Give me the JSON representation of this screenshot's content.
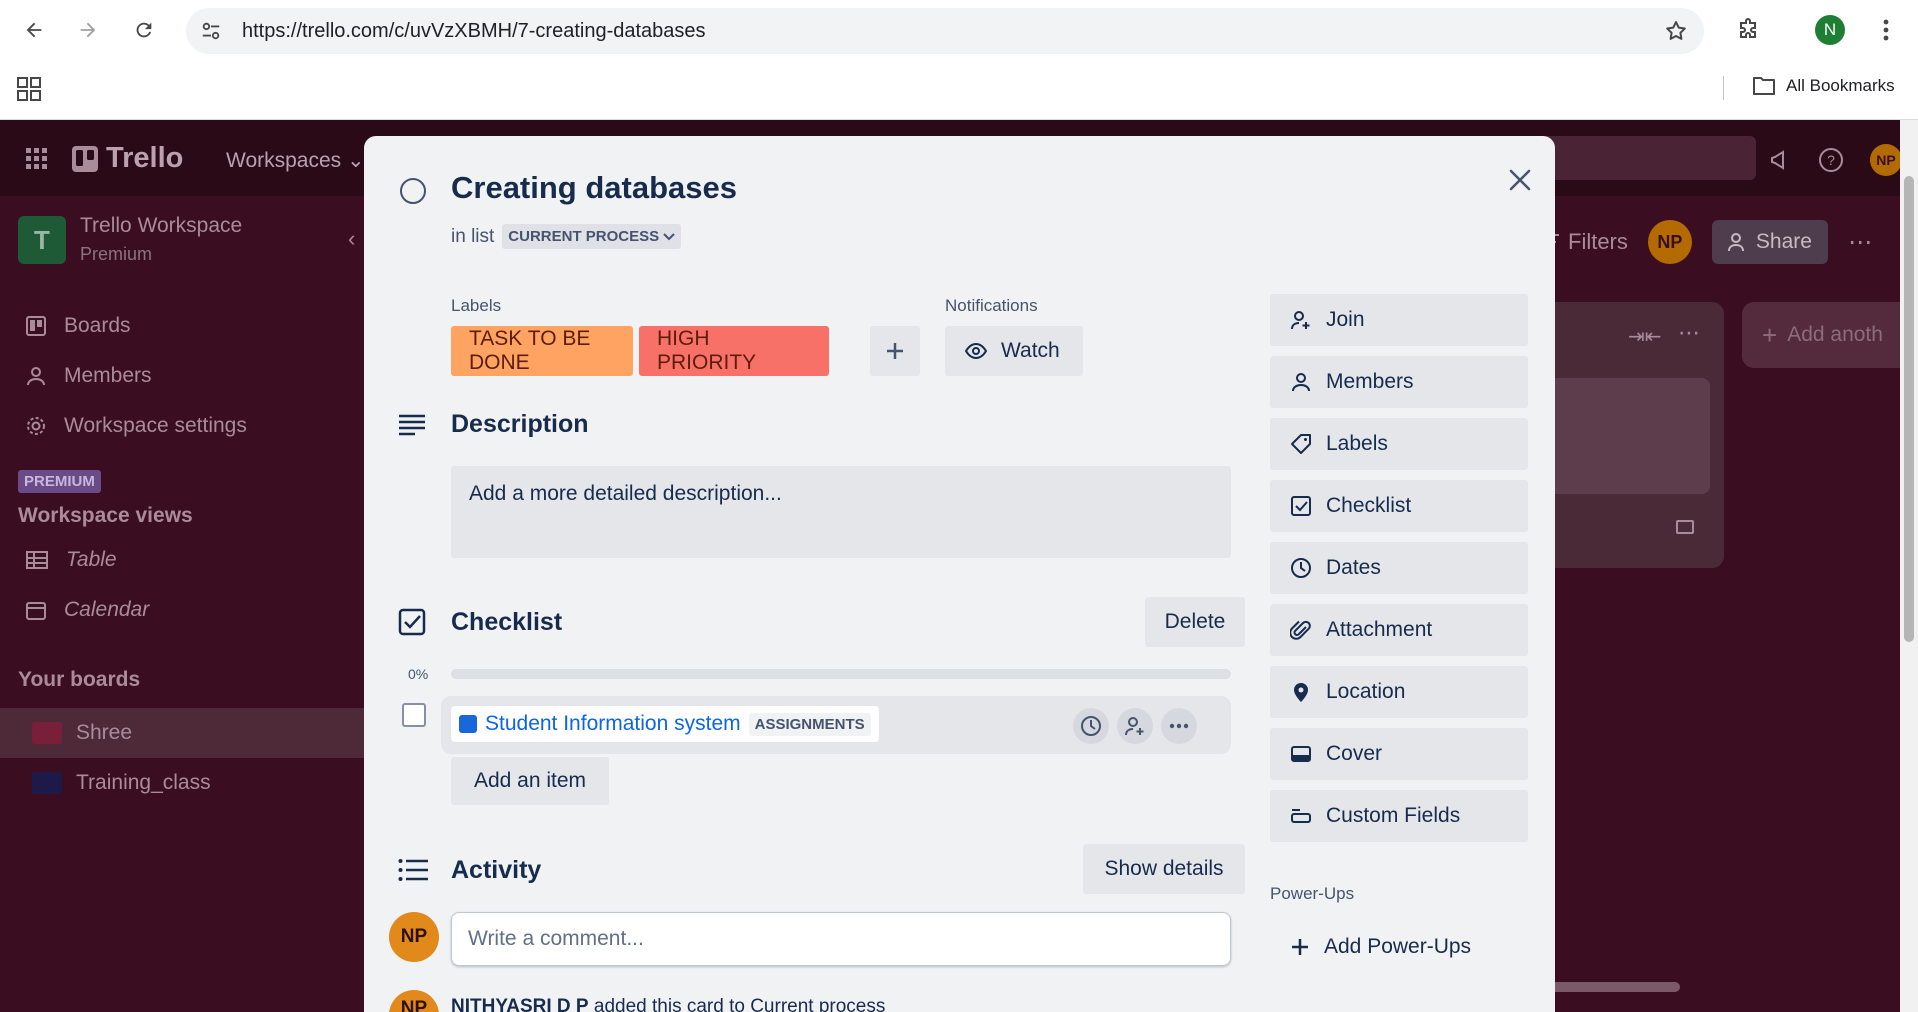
{
  "browser": {
    "url": "https://trello.com/c/uvVzXBMH/7-creating-databases",
    "profile_initial": "N",
    "bookmarks_label": "All Bookmarks"
  },
  "trello": {
    "logo_text": "Trello",
    "workspaces_menu": "Workspaces",
    "avatar_initials": "NP",
    "workspace": {
      "initial": "T",
      "name": "Trello Workspace",
      "plan": "Premium"
    },
    "sidebar": {
      "items": [
        {
          "label": "Boards",
          "icon": "board-icon"
        },
        {
          "label": "Members",
          "icon": "person-icon"
        },
        {
          "label": "Workspace settings",
          "icon": "gear-icon"
        }
      ],
      "premium_badge": "PREMIUM",
      "views_heading": "Workspace views",
      "views": [
        {
          "label": "Table",
          "icon": "table-icon"
        },
        {
          "label": "Calendar",
          "icon": "calendar-icon"
        }
      ],
      "boards_heading": "Your boards",
      "boards": [
        {
          "name": "Shree",
          "color": "#7a1f3a"
        },
        {
          "name": "Training_class",
          "color": "#1d1a4a"
        }
      ]
    },
    "board_header": {
      "filters_label": "Filters",
      "share_label": "Share"
    },
    "add_list_label": "Add anoth"
  },
  "card": {
    "title": "Creating databases",
    "in_list_prefix": "in list",
    "list_name": "CURRENT PROCESS",
    "labels_heading": "Labels",
    "labels": [
      {
        "text": "TASK TO BE DONE",
        "color": "#fea362"
      },
      {
        "text": "HIGH PRIORITY",
        "color": "#f87168"
      }
    ],
    "notifications_heading": "Notifications",
    "watch_label": "Watch",
    "description_heading": "Description",
    "description_placeholder": "Add a more detailed description...",
    "checklist": {
      "heading": "Checklist",
      "delete_label": "Delete",
      "progress_percent": 0,
      "progress_text": "0%",
      "items": [
        {
          "title": "Student Information system",
          "badge": "ASSIGNMENTS",
          "checked": false
        }
      ],
      "add_item_label": "Add an item"
    },
    "activity": {
      "heading": "Activity",
      "show_details_label": "Show details",
      "comment_placeholder": "Write a comment...",
      "comment_avatar": "NP",
      "entry_user": "NITHYASRI D P",
      "entry_text": " added this card to Current process"
    },
    "sidebar_actions": [
      {
        "label": "Join",
        "icon": "person-plus-icon"
      },
      {
        "label": "Members",
        "icon": "person-icon"
      },
      {
        "label": "Labels",
        "icon": "tag-icon"
      },
      {
        "label": "Checklist",
        "icon": "checklist-icon"
      },
      {
        "label": "Dates",
        "icon": "clock-icon"
      },
      {
        "label": "Attachment",
        "icon": "paperclip-icon"
      },
      {
        "label": "Location",
        "icon": "location-pin-icon"
      },
      {
        "label": "Cover",
        "icon": "cover-icon"
      },
      {
        "label": "Custom Fields",
        "icon": "custom-fields-icon"
      }
    ],
    "powerups_heading": "Power-Ups",
    "add_powerups_label": "Add Power-Ups"
  }
}
